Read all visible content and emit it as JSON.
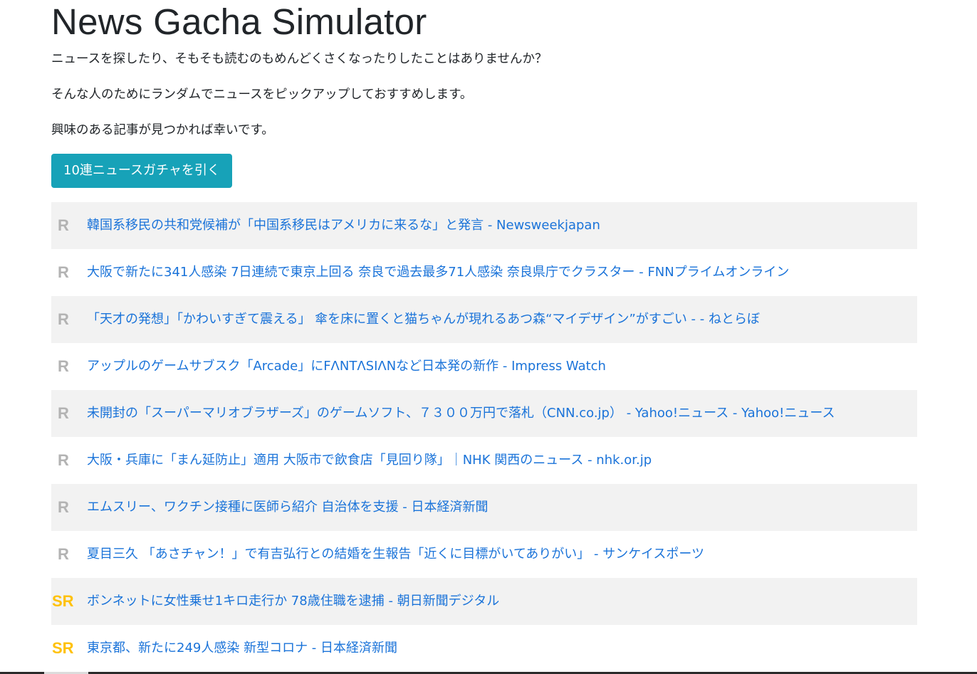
{
  "page": {
    "title": "News Gacha Simulator",
    "intro": [
      "ニュースを探したり、そもそも読むのもめんどくさくなったりしたことはありませんか？",
      "そんな人のためにランダムでニュースをピックアップしておすすめします。",
      "興味のある記事が見つかれば幸いです。"
    ],
    "gacha_button_label": "10連ニュースガチャを引く"
  },
  "colors": {
    "button_bg": "#17a2b8",
    "link": "#1a73d9",
    "rarity_r": "#b3b3b3",
    "rarity_sr": "#ffc107",
    "stripe": "#f2f2f2"
  },
  "news": [
    {
      "rarity": "R",
      "title": "韓国系移民の共和党候補が「中国系移民はアメリカに来るな」と発言 - Newsweekjapan"
    },
    {
      "rarity": "R",
      "title": "大阪で新たに341人感染 7日連続で東京上回る 奈良で過去最多71人感染 奈良県庁でクラスター - FNNプライムオンライン"
    },
    {
      "rarity": "R",
      "title": "「天才の発想」「かわいすぎて震える」 傘を床に置くと猫ちゃんが現れるあつ森“マイデザイン”がすごい - - ねとらぼ"
    },
    {
      "rarity": "R",
      "title": "アップルのゲームサブスク「Arcade」にFΛNTΛSIΛNなど日本発の新作 - Impress Watch"
    },
    {
      "rarity": "R",
      "title": "未開封の「スーパーマリオブラザーズ」のゲームソフト、７３００万円で落札（CNN.co.jp） - Yahoo!ニュース - Yahoo!ニュース"
    },
    {
      "rarity": "R",
      "title": "大阪・兵庫に「まん延防止」適用 大阪市で飲食店「見回り隊」｜NHK 関西のニュース - nhk.or.jp"
    },
    {
      "rarity": "R",
      "title": "エムスリー、ワクチン接種に医師ら紹介 自治体を支援 - 日本経済新聞"
    },
    {
      "rarity": "R",
      "title": "夏目三久 「あさチャン！」で有吉弘行との結婚を生報告「近くに目標がいてありがい」 - サンケイスポーツ"
    },
    {
      "rarity": "SR",
      "title": "ボンネットに女性乗せ1キロ走行か 78歳住職を逮捕 - 朝日新聞デジタル"
    },
    {
      "rarity": "SR",
      "title": "東京都、新たに249人感染 新型コロナ - 日本経済新聞"
    }
  ]
}
